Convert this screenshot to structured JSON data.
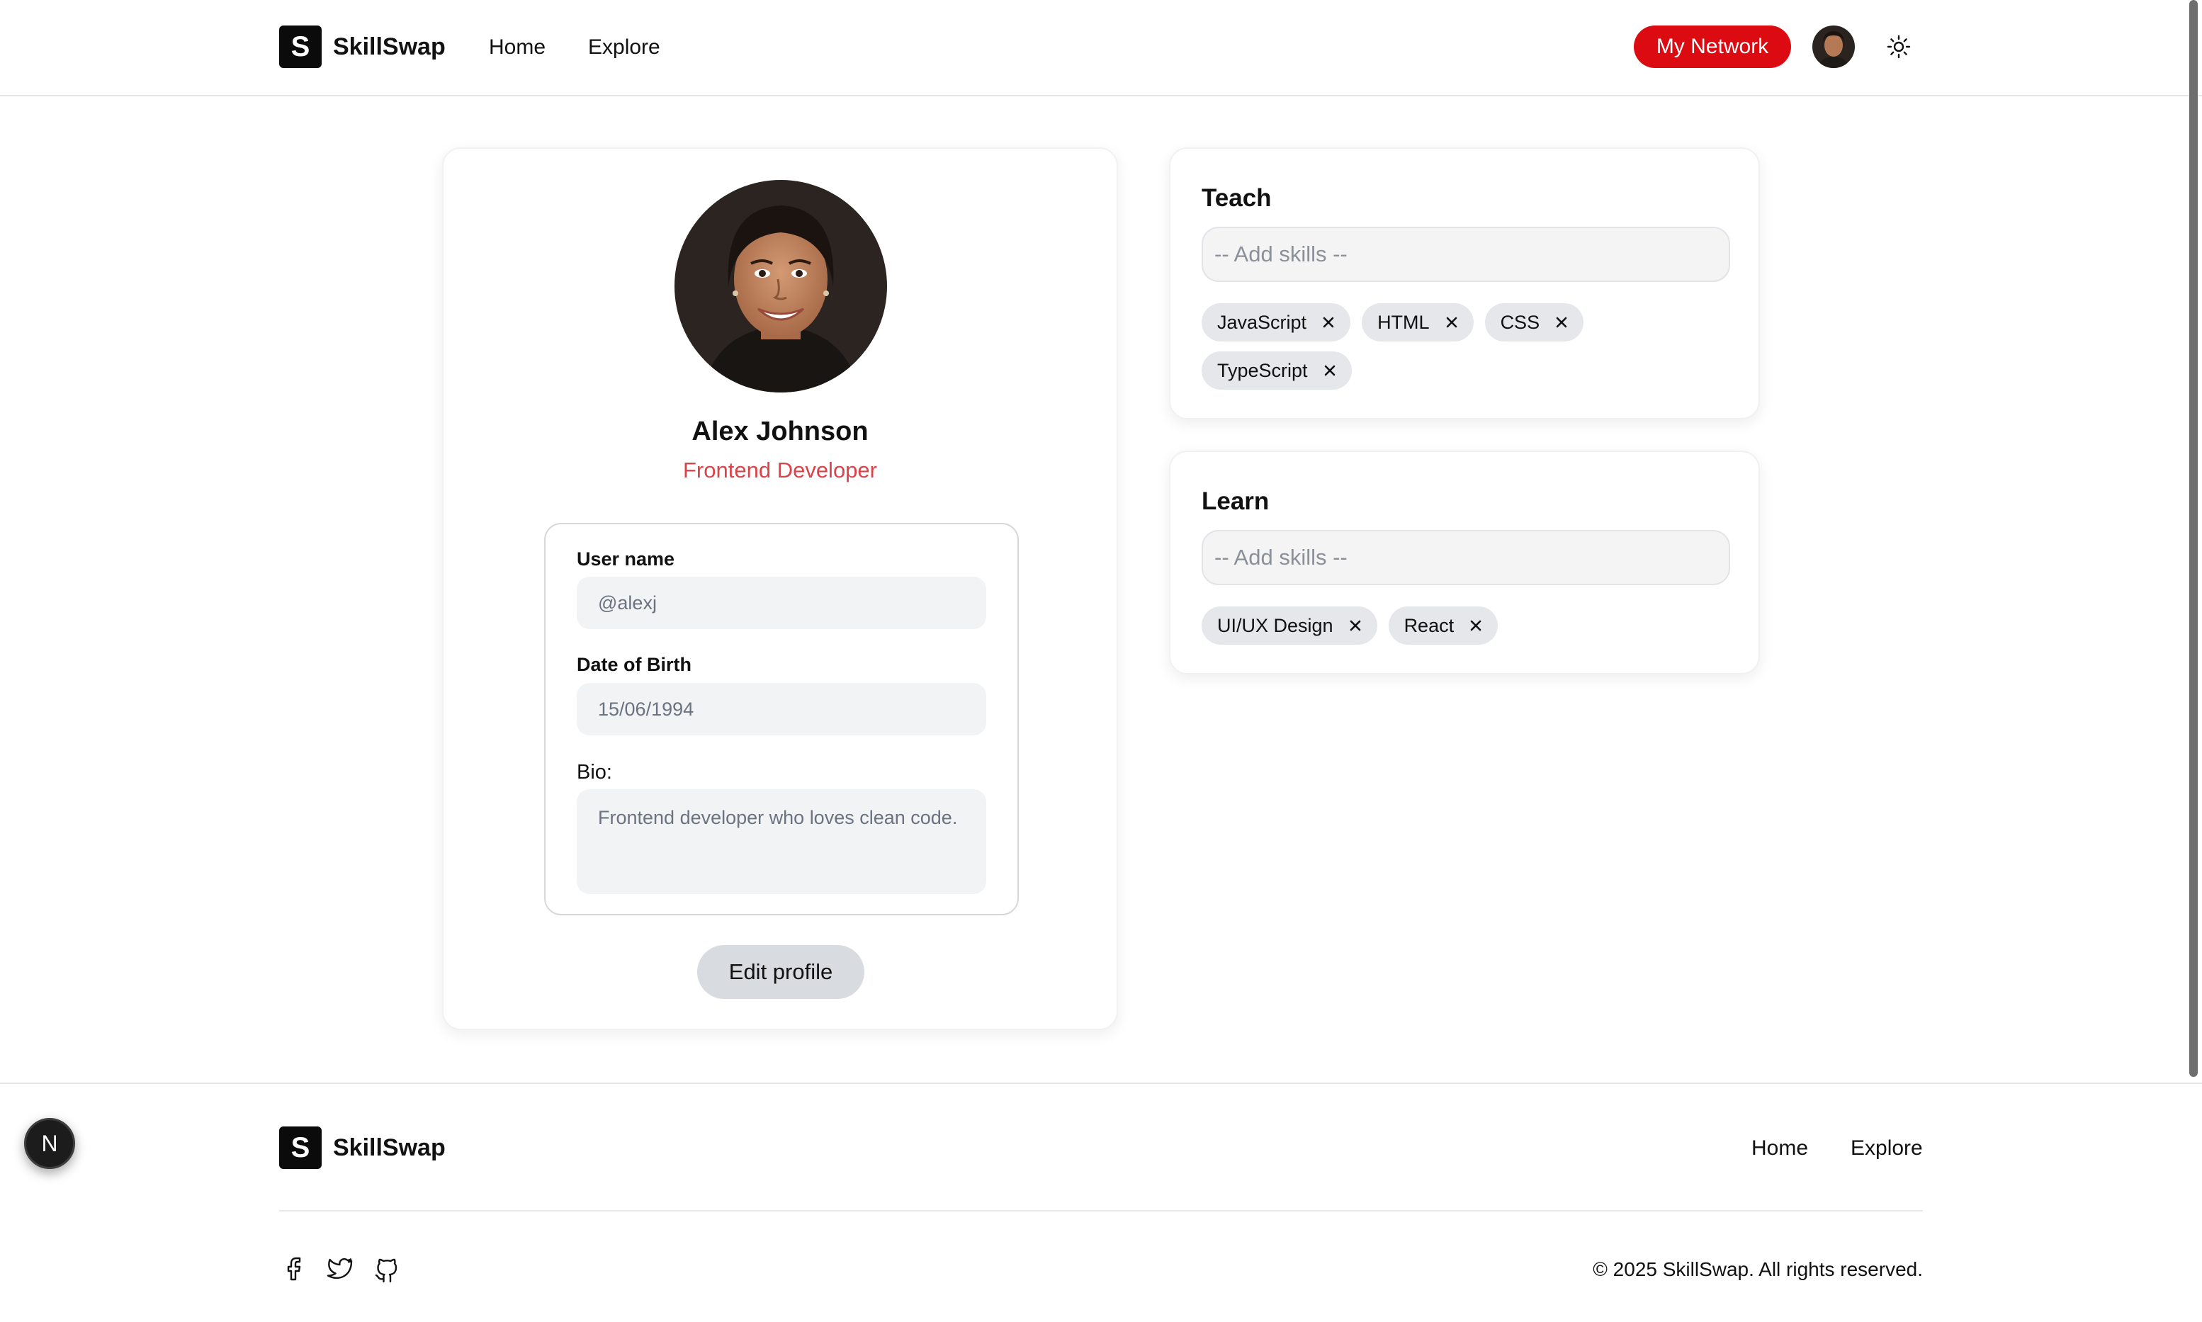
{
  "brand": {
    "name": "SkillSwap",
    "mark": "S"
  },
  "nav": {
    "home": "Home",
    "explore": "Explore"
  },
  "header": {
    "network_button": "My Network",
    "avatar_icon": "user-avatar",
    "theme_icon": "sun-icon"
  },
  "profile": {
    "name": "Alex Johnson",
    "role": "Frontend Developer",
    "fields": {
      "username_label": "User name",
      "username_value": "@alexj",
      "dob_label": "Date of Birth",
      "dob_value": "15/06/1994",
      "bio_label": "Bio:",
      "bio_value": "Frontend developer who loves clean code."
    },
    "edit_button": "Edit profile"
  },
  "teach": {
    "title": "Teach",
    "placeholder": "-- Add skills --",
    "skills": [
      "JavaScript",
      "HTML",
      "CSS",
      "TypeScript"
    ]
  },
  "learn": {
    "title": "Learn",
    "placeholder": "-- Add skills --",
    "skills": [
      "UI/UX Design",
      "React"
    ]
  },
  "footer": {
    "links": {
      "home": "Home",
      "explore": "Explore"
    },
    "social_icons": [
      "facebook-icon",
      "twitter-icon",
      "github-icon"
    ],
    "copyright": "© 2025 SkillSwap. All rights reserved."
  },
  "dev_badge": "N",
  "colors": {
    "accent": "#dc0b12",
    "role_text": "#d9434a",
    "brand_dark": "#0b0b0b"
  }
}
